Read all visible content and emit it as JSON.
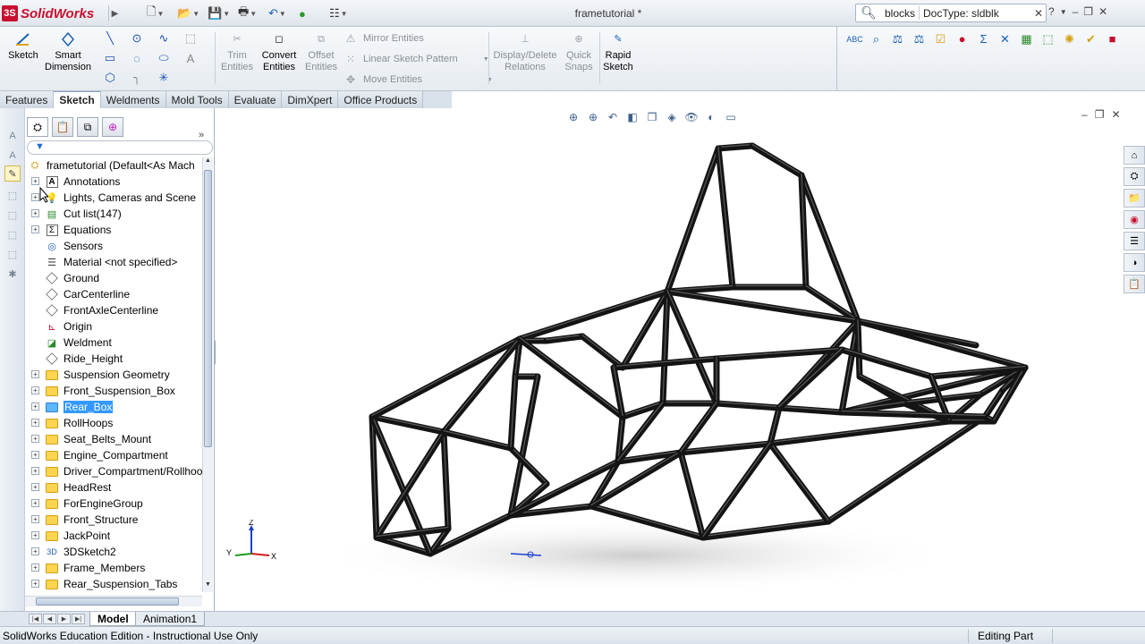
{
  "app": {
    "brand": "SolidWorks",
    "doc_title": "frametutorial *"
  },
  "search": {
    "scope": "blocks",
    "value": "DocType: sldblk"
  },
  "commands": {
    "sketch": "Sketch",
    "smart_dimension_l1": "Smart",
    "smart_dimension_l2": "Dimension",
    "trim_l1": "Trim",
    "trim_l2": "Entities",
    "convert_l1": "Convert",
    "convert_l2": "Entities",
    "offset_l1": "Offset",
    "offset_l2": "Entities",
    "mirror": "Mirror Entities",
    "linear_pattern": "Linear Sketch Pattern",
    "move": "Move Entities",
    "display_delete_l1": "Display/Delete",
    "display_delete_l2": "Relations",
    "quick_snaps_l1": "Quick",
    "quick_snaps_l2": "Snaps",
    "rapid_l1": "Rapid",
    "rapid_l2": "Sketch"
  },
  "tabs": [
    "Features",
    "Sketch",
    "Weldments",
    "Mold Tools",
    "Evaluate",
    "DimXpert",
    "Office Products"
  ],
  "active_tab": "Sketch",
  "tree": {
    "root": "frametutorial  (Default<As Mach",
    "items": [
      {
        "label": "Annotations",
        "icon": "annotations-icon",
        "expand": true
      },
      {
        "label": "Lights, Cameras and Scene",
        "icon": "lights-icon",
        "expand": true
      },
      {
        "label": "Cut list(147)",
        "icon": "cut-list-icon",
        "expand": true
      },
      {
        "label": "Equations",
        "icon": "equations-icon",
        "expand": true
      },
      {
        "label": "Sensors",
        "icon": "sensors-icon",
        "expand": false
      },
      {
        "label": "Material <not specified>",
        "icon": "material-icon",
        "expand": false
      },
      {
        "label": "Ground",
        "icon": "plane-icon",
        "expand": false
      },
      {
        "label": "CarCenterline",
        "icon": "plane-icon",
        "expand": false
      },
      {
        "label": "FrontAxleCenterline",
        "icon": "plane-icon",
        "expand": false
      },
      {
        "label": "Origin",
        "icon": "origin-icon",
        "expand": false
      },
      {
        "label": "Weldment",
        "icon": "weldment-icon",
        "expand": false
      },
      {
        "label": "Ride_Height",
        "icon": "plane-icon",
        "expand": false
      },
      {
        "label": "Suspension Geometry",
        "icon": "folder-icon",
        "expand": true
      },
      {
        "label": "Front_Suspension_Box",
        "icon": "folder-icon",
        "expand": true
      },
      {
        "label": "Rear_Box",
        "icon": "folder-icon",
        "expand": true,
        "selected": true
      },
      {
        "label": "RollHoops",
        "icon": "folder-icon",
        "expand": true
      },
      {
        "label": "Seat_Belts_Mount",
        "icon": "folder-icon",
        "expand": true
      },
      {
        "label": "Engine_Compartment",
        "icon": "folder-icon",
        "expand": true
      },
      {
        "label": "Driver_Compartment/Rollhoo",
        "icon": "folder-icon",
        "expand": true
      },
      {
        "label": "HeadRest",
        "icon": "folder-icon",
        "expand": true
      },
      {
        "label": "ForEngineGroup",
        "icon": "folder-icon",
        "expand": true
      },
      {
        "label": "Front_Structure",
        "icon": "folder-icon",
        "expand": true
      },
      {
        "label": "JackPoint",
        "icon": "folder-icon",
        "expand": true
      },
      {
        "label": "3DSketch2",
        "icon": "sketch3d-icon",
        "expand": true
      },
      {
        "label": "Frame_Members",
        "icon": "folder-icon",
        "expand": true
      },
      {
        "label": "Rear_Suspension_Tabs",
        "icon": "folder-icon",
        "expand": true
      }
    ]
  },
  "bottom_tabs": [
    "Model",
    "Animation1"
  ],
  "triad": {
    "x": "X",
    "y": "Y",
    "z": "Z"
  },
  "status": {
    "left": "SolidWorks Education Edition - Instructional Use Only",
    "right": "Editing Part"
  },
  "colors": {
    "frame": "#141414",
    "selection": "#3399ff",
    "brand": "#c8102e"
  }
}
